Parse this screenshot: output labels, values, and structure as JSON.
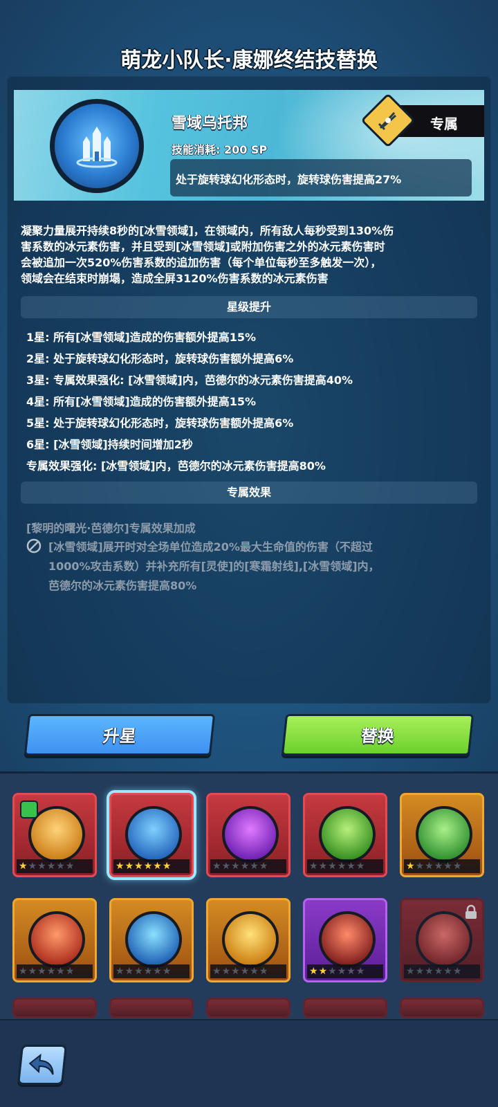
{
  "header": {
    "title": "萌龙小队长·康娜终结技替换"
  },
  "skill": {
    "name": "雪域乌托邦",
    "cost": "技能消耗: 200 SP",
    "form_effect": "处于旋转球幻化形态时，旋转球伤害提高27%",
    "exclusive_label": "专属",
    "icon": "snow-castle-icon"
  },
  "description": {
    "lines": [
      "凝聚力量展开持续8秒的[冰雪领域]，在领域内，所有敌人每秒受到130%伤",
      "害系数的冰元素伤害，并且受到[冰雪领域]或附加伤害之外的冰元素伤害时",
      "会被追加一次520%伤害系数的追加伤害（每个单位每秒至多触发一次），",
      "领域会在结束时崩塌，造成全屏3120%伤害系数的冰元素伤害"
    ]
  },
  "star_upgrade": {
    "title": "星级提升",
    "items": [
      "1星: 所有[冰雪领域]造成的伤害额外提高15%",
      "2星: 处于旋转球幻化形态时，旋转球伤害额外提高6%",
      "3星: 专属效果强化: [冰雪领域]内，芭德尔的冰元素伤害提高40%",
      "4星: 所有[冰雪领域]造成的伤害额外提高15%",
      "5星: 处于旋转球幻化形态时，旋转球伤害额外提高6%",
      "6星: [冰雪领域]持续时间增加2秒",
      "专属效果强化: [冰雪领域]内，芭德尔的冰元素伤害提高80%"
    ]
  },
  "exclusive": {
    "title": "专属效果",
    "source": "[黎明的曙光·芭德尔]专属效果加成",
    "lines": [
      "[冰雪领域]展开时对全场单位造成20%最大生命值的伤害（不超过",
      "1000%攻击系数）并补充所有[灵使]的[寒霜射线],[冰雪领域]内，",
      "芭德尔的冰元素伤害提高80%"
    ]
  },
  "buttons": {
    "star_up": "升星",
    "replace": "替换"
  },
  "skill_grid": [
    {
      "icon": "thunder-ball-icon",
      "frame": "red",
      "stars": 1,
      "colors": [
        "#ffd27a",
        "#c87a12"
      ],
      "badge": true
    },
    {
      "icon": "snow-castle-icon",
      "frame": "red",
      "stars": 6,
      "colors": [
        "#7fd0ff",
        "#1f5fb8"
      ],
      "selected": true
    },
    {
      "icon": "purple-planet-icon",
      "frame": "red",
      "stars": 0,
      "colors": [
        "#e07aff",
        "#6a1cb0"
      ]
    },
    {
      "icon": "green-swirl-icon",
      "frame": "red",
      "stars": 0,
      "colors": [
        "#b6f07a",
        "#2f8a1c"
      ]
    },
    {
      "icon": "green-arrow-icon",
      "frame": "gold",
      "stars": 1,
      "colors": [
        "#a8f08a",
        "#2a8a2a"
      ]
    },
    {
      "icon": "meteor-icon",
      "frame": "gold",
      "stars": 0,
      "colors": [
        "#ff9a6a",
        "#a8281a"
      ]
    },
    {
      "icon": "ice-shard-icon",
      "frame": "gold",
      "stars": 0,
      "colors": [
        "#8ae0ff",
        "#1a5ab0"
      ]
    },
    {
      "icon": "lightning-icon",
      "frame": "gold",
      "stars": 0,
      "colors": [
        "#ffe27a",
        "#c8780c"
      ]
    },
    {
      "icon": "fire-orb-icon",
      "frame": "purple",
      "stars": 2,
      "colors": [
        "#ff8a6a",
        "#7a1a1a"
      ]
    },
    {
      "icon": "explosion-icon",
      "frame": "locked",
      "stars": 0,
      "colors": [
        "#e8706a",
        "#7a1e1e"
      ],
      "locked": true
    }
  ]
}
